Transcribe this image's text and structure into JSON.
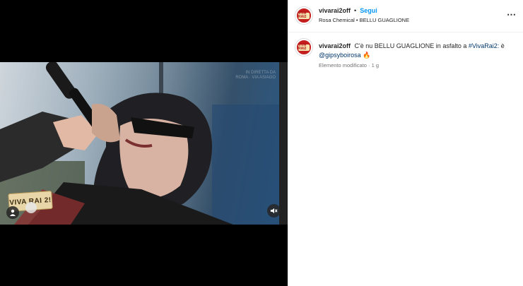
{
  "header": {
    "username": "vivarai2off",
    "separator": "•",
    "follow_label": "Segui",
    "audio": "Rosa Chemical • BELLU GUAGLIONE",
    "more_icon": "⋯"
  },
  "caption": {
    "username": "vivarai2off",
    "text_before": "C'è nu BELLU GUAGLIONE in asfalto a",
    "hashtag": "#VivaRai2:",
    "text_mid": "è",
    "mention": "@gipsyboirosa",
    "emoji": "🔥",
    "meta_edited": "Elemento modificato",
    "meta_sep": "·",
    "meta_age": "1 g"
  },
  "avatar_logo_text": "VIVA RAI2",
  "video": {
    "logo_text": "VIVA RAI 2!",
    "watermark": "IN DIRETTA DA ROMA · VIA ASIAGO"
  },
  "colors": {
    "accent": "#0095f6",
    "link": "#00376b",
    "avatar_bg": "#c41e1e"
  },
  "icons": [
    "user-tag-icon",
    "mute-icon",
    "more-options-icon"
  ]
}
